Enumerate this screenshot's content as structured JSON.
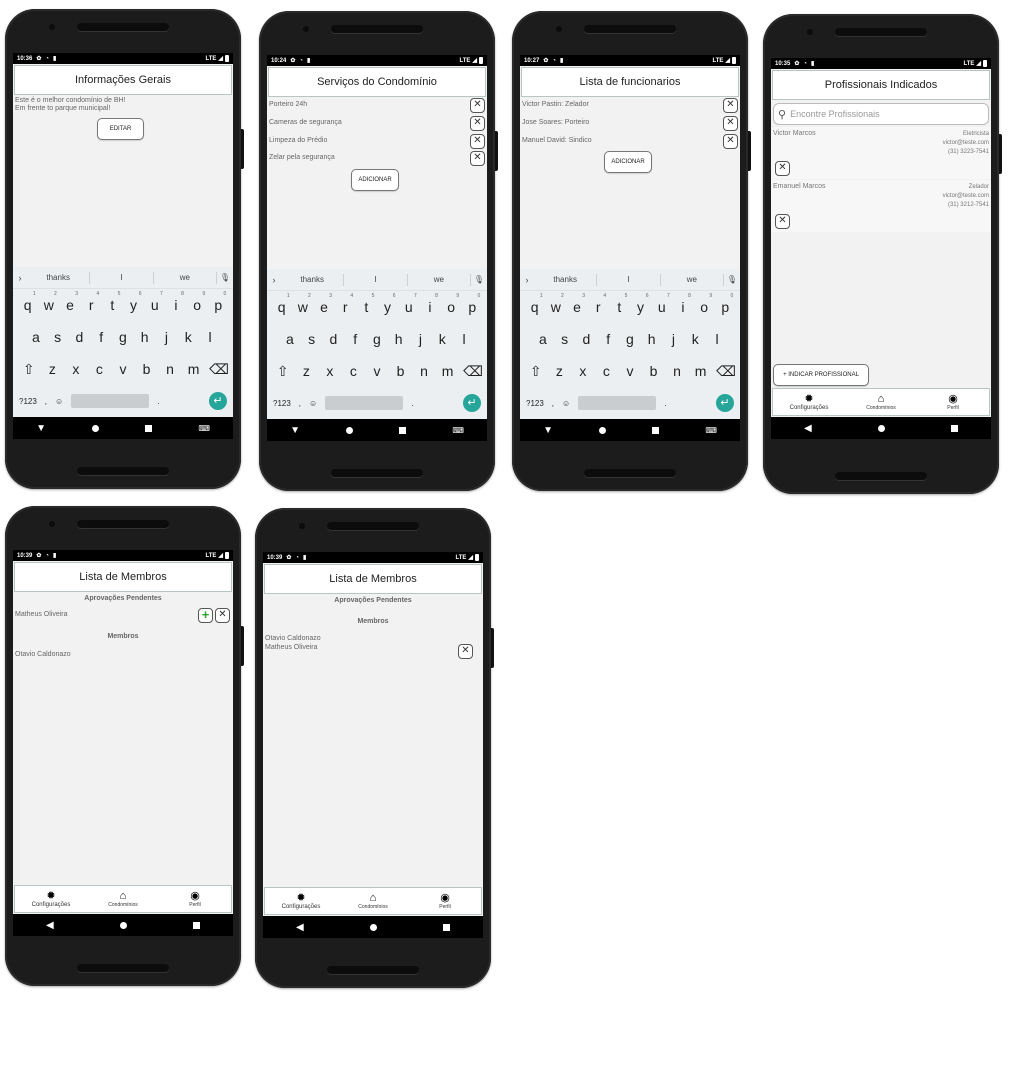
{
  "statusbar": {
    "network": "LTE"
  },
  "keyboard": {
    "suggestions": [
      "thanks",
      "I",
      "we"
    ],
    "row1": [
      "q",
      "w",
      "e",
      "r",
      "t",
      "y",
      "u",
      "i",
      "o",
      "p"
    ],
    "row1_digits": [
      "1",
      "2",
      "3",
      "4",
      "5",
      "6",
      "7",
      "8",
      "9",
      "0"
    ],
    "row2": [
      "a",
      "s",
      "d",
      "f",
      "g",
      "h",
      "j",
      "k",
      "l"
    ],
    "row3": [
      "z",
      "x",
      "c",
      "v",
      "b",
      "n",
      "m"
    ],
    "symbols_key": "?123",
    "comma_key": ",",
    "period_key": "."
  },
  "tabs": {
    "config": "Configurações",
    "condos": "Condomínios",
    "profile": "Perfil"
  },
  "screens": {
    "info": {
      "time": "10:36",
      "title": "Informações Gerais",
      "text1": "Este é o melhor condomínio de BH!",
      "text2": "Em frente to parque municipal!",
      "edit_button": "EDITAR"
    },
    "services": {
      "time": "10:24",
      "title": "Serviços do Condomínio",
      "items": [
        "Porteiro 24h",
        "Cameras de segurança",
        "Limpeza do Prédio",
        "Zelar pela segurança"
      ],
      "add_button": "ADICIONAR"
    },
    "staff": {
      "time": "10:27",
      "title": "Lista de funcionarios",
      "items": [
        "Victor Pastin: Zelador",
        "Jose Soares: Porteiro",
        "Manuel David: Sindico"
      ],
      "add_button": "ADICIONAR"
    },
    "pros": {
      "time": "10:35",
      "title": "Profissionais Indicados",
      "search_placeholder": "Encontre Profissionais",
      "items": [
        {
          "name": "Victor Marcos",
          "role": "Eletricista",
          "email": "victor@teste.com",
          "phone": "(31) 3223-7541"
        },
        {
          "name": "Emanuel Marcos",
          "role": "Zelador",
          "email": "victor@teste.com",
          "phone": "(31) 3212-7541"
        }
      ],
      "indicate_button": "+ INDICAR PROFISSIONAL"
    },
    "members1": {
      "time": "10:39",
      "title": "Lista de Membros",
      "pending_header": "Aprovações Pendentes",
      "pending": [
        "Matheus Oliveira"
      ],
      "members_header": "Membros",
      "members": [
        "Otavio Caldonazo"
      ]
    },
    "members2": {
      "time": "10:39",
      "title": "Lista de Membros",
      "pending_header": "Aprovações Pendentes",
      "members_header": "Membros",
      "members": [
        "Otavio Caldonazo",
        "Matheus Oliveira"
      ]
    }
  }
}
